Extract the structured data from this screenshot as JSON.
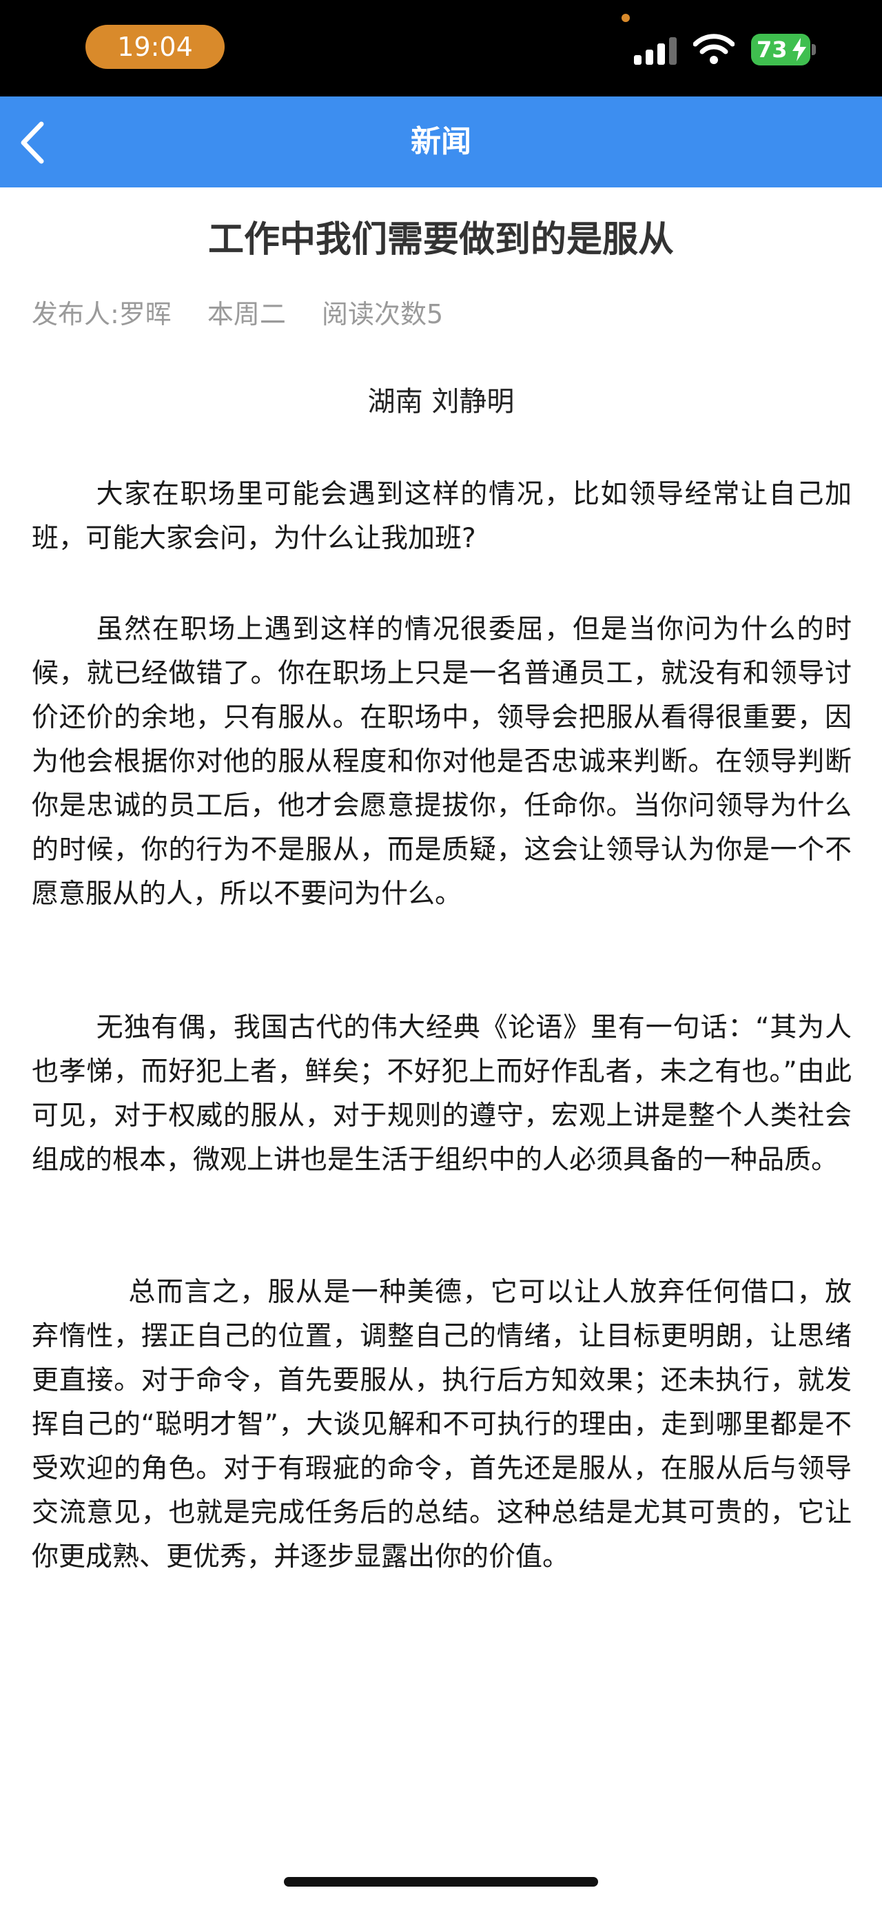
{
  "status_bar": {
    "time": "19:04",
    "battery": "73",
    "icons": [
      "signal-icon",
      "wifi-icon",
      "battery-icon",
      "charging-bolt-icon"
    ]
  },
  "nav": {
    "title": "新闻",
    "back_icon": "chevron-left-icon"
  },
  "colors": {
    "nav_background": "#3d8ef0",
    "status_bar_background": "#000000",
    "time_pill": "#d98a2b",
    "battery": "#3fbf4f",
    "meta_text": "#9a9a9a"
  },
  "article": {
    "title": "工作中我们需要做到的是服从",
    "meta": {
      "publisher": "发布人:罗晖",
      "date": "本周二",
      "reads": "阅读次数5"
    },
    "author_line": "湖南  刘静明",
    "paragraphs": [
      "大家在职场里可能会遇到这样的情况，比如领导经常让自己加班，可能大家会问，为什么让我加班?",
      "虽然在职场上遇到这样的情况很委屈，但是当你问为什么的时候，就已经做错了。你在职场上只是一名普通员工，就没有和领导讨价还价的余地，只有服从。在职场中，领导会把服从看得很重要，因为他会根据你对他的服从程度和你对他是否忠诚来判断。在领导判断你是忠诚的员工后，他才会愿意提拔你，任命你。当你问领导为什么的时候，你的行为不是服从，而是质疑，这会让领导认为你是一个不愿意服从的人，所以不要问为什么。",
      "无独有偶，我国古代的伟大经典《论语》里有一句话：“其为人也孝悌，而好犯上者，鲜矣；不好犯上而好作乱者，未之有也。”由此可见，对于权威的服从，对于规则的遵守，宏观上讲是整个人类社会组成的根本，微观上讲也是生活于组织中的人必须具备的一种品质。",
      "总而言之，服从是一种美德，它可以让人放弃任何借口，放弃惰性，摆正自己的位置，调整自己的情绪，让目标更明朗，让思绪更直接。对于命令，首先要服从，执行后方知效果；还未执行，就发挥自己的“聪明才智”，大谈见解和不可执行的理由，走到哪里都是不受欢迎的角色。对于有瑕疵的命令，首先还是服从，在服从后与领导交流意见，也就是完成任务后的总结。这种总结是尤其可贵的，它让你更成熟、更优秀，并逐步显露出你的价值。"
    ]
  }
}
